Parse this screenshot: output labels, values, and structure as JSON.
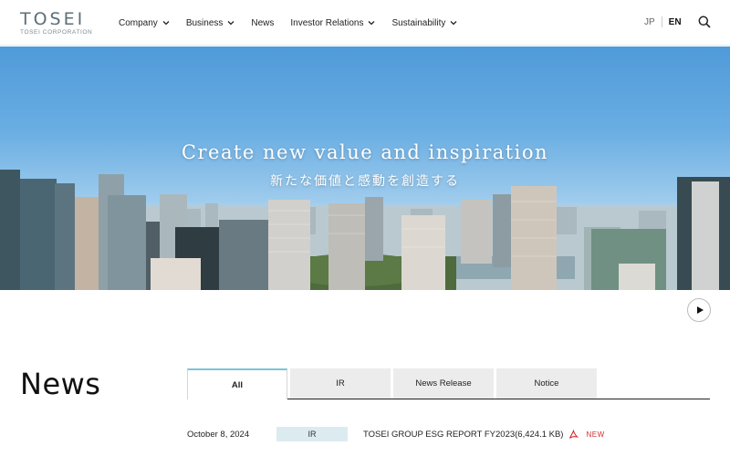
{
  "logo": {
    "word": "TOSEI",
    "sub": "TOSEI CORPORATION"
  },
  "nav": [
    {
      "label": "Company",
      "dropdown": true
    },
    {
      "label": "Business",
      "dropdown": true
    },
    {
      "label": "News",
      "dropdown": false
    },
    {
      "label": "Investor Relations",
      "dropdown": true
    },
    {
      "label": "Sustainability",
      "dropdown": true
    }
  ],
  "lang": {
    "jp": "JP",
    "en": "EN"
  },
  "hero": {
    "title": "Create new value and inspiration",
    "subtitle": "新たな価値と感動を創造する"
  },
  "news": {
    "heading": "News",
    "tabs": [
      "All",
      "IR",
      "News Release",
      "Notice"
    ],
    "active_tab": "All",
    "items": [
      {
        "date": "October 8, 2024",
        "tag": "IR",
        "title": "TOSEI GROUP ESG REPORT FY2023(6,424.1 KB)",
        "new_label": "NEW"
      }
    ]
  },
  "colors": {
    "accent": "#7cc4d8",
    "new": "#d12b2b",
    "tag_bg": "#dcebf0"
  }
}
